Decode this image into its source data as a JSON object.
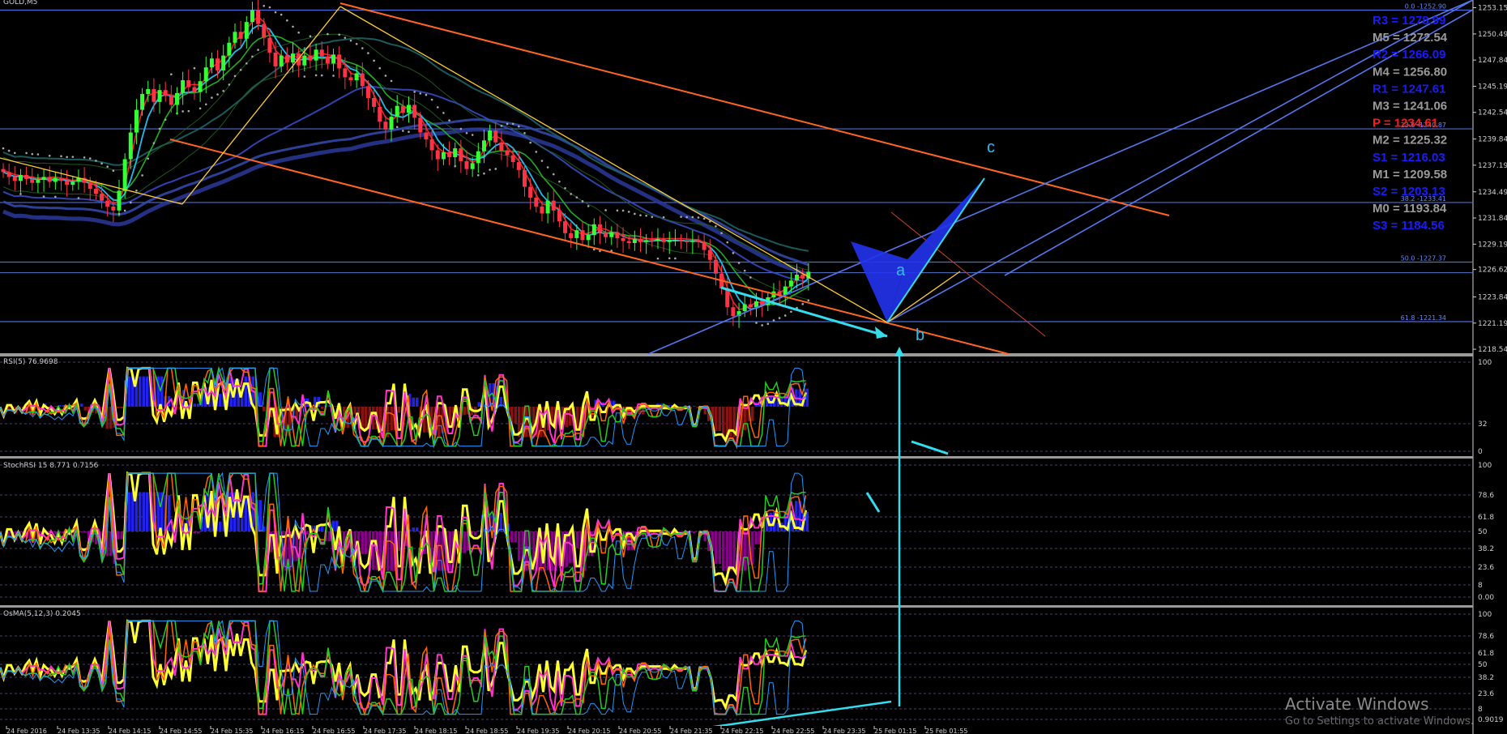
{
  "chart_data": {
    "type": "line",
    "symbol": "GOLD,M5",
    "price_axis": [
      "1253.15",
      "1250.49",
      "1247.84",
      "1245.19",
      "1242.54",
      "1239.84",
      "1237.19",
      "1234.49",
      "1231.84",
      "1229.19",
      "1226.62",
      "1223.84",
      "1221.19",
      "1218.54"
    ],
    "price_range": [
      1218.3,
      1253.6
    ],
    "time_axis": [
      "24 Feb 2016",
      "24 Feb 13:35",
      "24 Feb 14:15",
      "24 Feb 14:55",
      "24 Feb 15:35",
      "24 Feb 16:15",
      "24 Feb 16:55",
      "24 Feb 17:35",
      "24 Feb 18:15",
      "24 Feb 18:55",
      "24 Feb 19:35",
      "24 Feb 20:15",
      "24 Feb 20:55",
      "24 Feb 21:35",
      "24 Feb 22:15",
      "24 Feb 22:55",
      "24 Feb 23:35",
      "25 Feb 01:15",
      "25 Feb 01:55"
    ],
    "pivots": [
      {
        "label": "R3 = 1278.99",
        "color": "#1a1aff"
      },
      {
        "label": "M5 = 1272.54",
        "color": "#9a9a9a"
      },
      {
        "label": "R2 = 1266.09",
        "color": "#1a1aff"
      },
      {
        "label": "M4 = 1256.80",
        "color": "#9a9a9a"
      },
      {
        "label": "R1 = 1247.61",
        "color": "#1a1aff"
      },
      {
        "label": "M3 = 1241.06",
        "color": "#9a9a9a"
      },
      {
        "label": "P  = 1234.61",
        "color": "#ff1a1a"
      },
      {
        "label": "M2 = 1225.32",
        "color": "#9a9a9a"
      },
      {
        "label": "S1 = 1216.03",
        "color": "#1a1aff"
      },
      {
        "label": "M1 = 1209.58",
        "color": "#9a9a9a"
      },
      {
        "label": "S2 = 1203.13",
        "color": "#1a1aff"
      },
      {
        "label": "M0 = 1193.84",
        "color": "#9a9a9a"
      },
      {
        "label": "S3 = 1184.56",
        "color": "#1a1aff"
      }
    ],
    "fib_levels": [
      {
        "label": "0.0 -1252.90",
        "price": 1252.9
      },
      {
        "label": "23.6 -1240.87",
        "price": 1240.87
      },
      {
        "label": "38.2 -1233.41",
        "price": 1233.41
      },
      {
        "label": "50.0 -1227.37",
        "price": 1227.37
      },
      {
        "label": "61.8 -1221.34",
        "price": 1221.34
      }
    ],
    "pattern_labels": [
      "a",
      "b",
      "c"
    ],
    "close_series": [
      1236.5,
      1236.0,
      1235.6,
      1236.2,
      1235.8,
      1235.4,
      1235.7,
      1236.0,
      1235.5,
      1235.9,
      1235.6,
      1235.2,
      1235.5,
      1235.9,
      1235.4,
      1234.8,
      1234.3,
      1233.6,
      1233.0,
      1232.6,
      1234.6,
      1237.8,
      1240.5,
      1242.8,
      1244.4,
      1244.9,
      1243.6,
      1244.8,
      1244.2,
      1243.3,
      1244.5,
      1245.8,
      1245.1,
      1244.6,
      1245.7,
      1247.1,
      1248.0,
      1246.8,
      1248.3,
      1249.6,
      1250.7,
      1250.0,
      1251.7,
      1252.9,
      1251.5,
      1250.1,
      1248.6,
      1247.2,
      1248.3,
      1247.6,
      1248.5,
      1247.3,
      1248.3,
      1247.8,
      1248.9,
      1248.2,
      1247.5,
      1248.4,
      1247.0,
      1246.1,
      1245.8,
      1246.5,
      1245.2,
      1244.0,
      1243.1,
      1241.6,
      1240.8,
      1242.1,
      1243.2,
      1242.5,
      1243.3,
      1242.0,
      1240.5,
      1239.8,
      1238.7,
      1237.8,
      1238.5,
      1238.0,
      1238.9,
      1237.6,
      1236.8,
      1237.4,
      1238.6,
      1239.7,
      1240.7,
      1239.5,
      1238.7,
      1238.2,
      1237.5,
      1236.7,
      1235.0,
      1233.9,
      1233.0,
      1232.3,
      1233.6,
      1232.6,
      1231.5,
      1230.3,
      1229.8,
      1230.6,
      1229.6,
      1230.1,
      1231.2,
      1230.4,
      1229.9,
      1230.4,
      1229.8,
      1229.5,
      1229.3,
      1229.7,
      1229.4,
      1229.6,
      1229.5,
      1229.7,
      1229.4,
      1229.6,
      1229.6,
      1229.5,
      1229.4,
      1229.5,
      1229.4,
      1228.6,
      1227.6,
      1226.2,
      1224.7,
      1222.8,
      1221.9,
      1222.4,
      1223.1,
      1222.8,
      1223.4,
      1223.0,
      1223.8,
      1224.4,
      1224.0,
      1224.9,
      1225.5,
      1226.1,
      1225.7,
      1226.4
    ]
  },
  "watermark": {
    "title": "Activate Windows",
    "subtitle": "Go to Settings to activate Windows."
  },
  "indicators": {
    "rsi": {
      "label": "RSI(5) 76.9698",
      "levels": [
        "100",
        "32",
        "0"
      ]
    },
    "stoch": {
      "label": "StochRSI 15 8.771 0.7156",
      "levels": [
        "100",
        "78.6",
        "61.8",
        "50",
        "38.2",
        "23.6",
        "8",
        "0.00"
      ]
    },
    "osma": {
      "label": "OsMA(5,12,3) 0.2045",
      "levels": [
        "100",
        "78.6",
        "61.8",
        "50",
        "38.2",
        "23.6",
        "8",
        "0.9019"
      ]
    }
  },
  "colors": {
    "bull": "#33ff33",
    "bear": "#ff3344",
    "yellow": "#ffff33",
    "cyan": "#33ccff",
    "orange": "#ff6622",
    "blue": "#5577ee",
    "hist_blue": "#2222ee",
    "hist_red": "#881111",
    "hist_purple": "#880088"
  }
}
